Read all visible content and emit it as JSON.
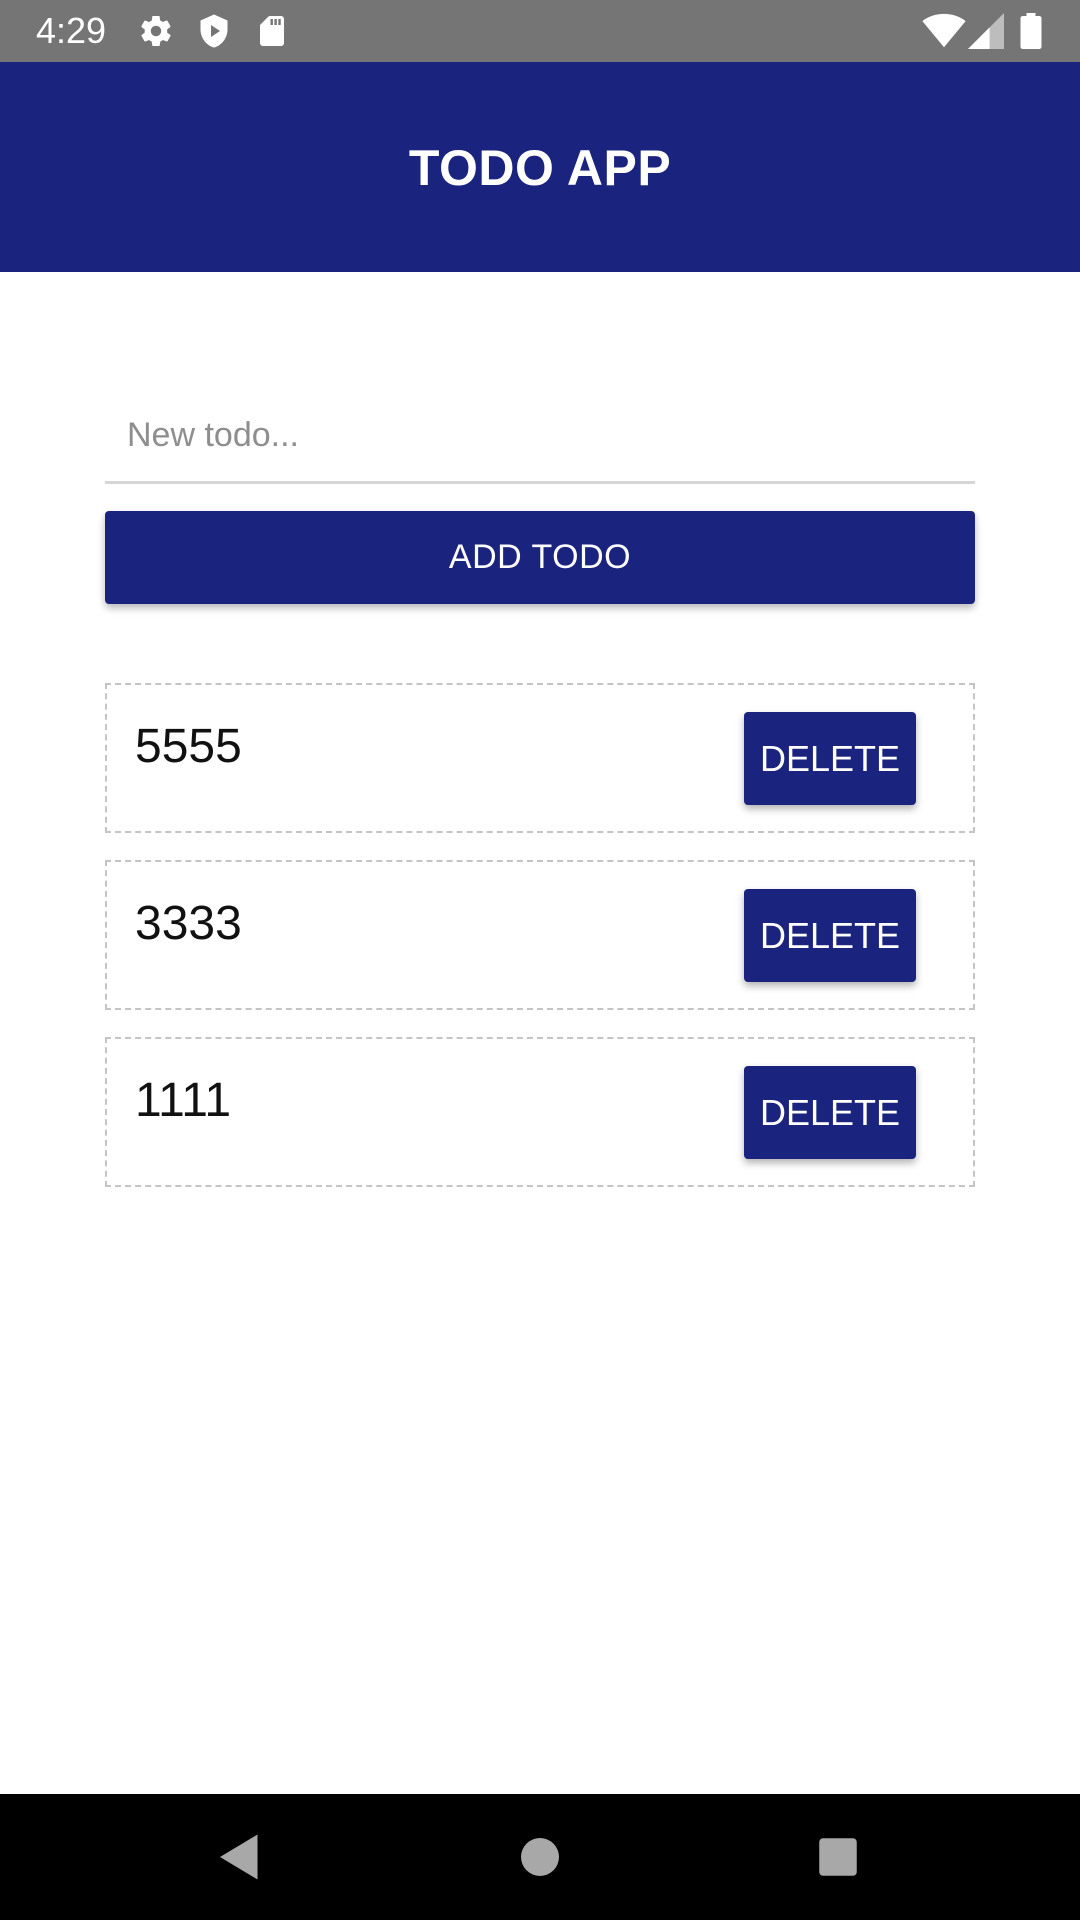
{
  "status_bar": {
    "time": "4:29",
    "icons_left": [
      "gear-icon",
      "shield-play-icon",
      "sd-card-icon"
    ],
    "icons_right": [
      "wifi-icon",
      "cell-signal-icon",
      "battery-icon"
    ]
  },
  "app_bar": {
    "title": "TODO APP",
    "color": "#1a237e"
  },
  "new_todo": {
    "value": "",
    "placeholder": "New todo..."
  },
  "add_button": {
    "label": "ADD TODO"
  },
  "todos": [
    {
      "text": "5555",
      "delete_label": "DELETE"
    },
    {
      "text": "3333",
      "delete_label": "DELETE"
    },
    {
      "text": "1111",
      "delete_label": "DELETE"
    }
  ],
  "nav_bar": {
    "buttons": [
      "back-icon",
      "home-icon",
      "recents-icon"
    ]
  }
}
